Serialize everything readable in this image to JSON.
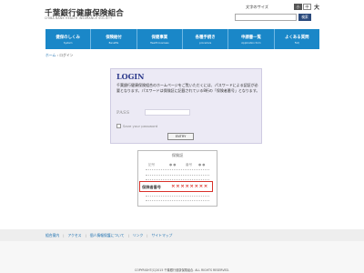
{
  "header": {
    "site_title": "千葉銀行健康保険組合",
    "site_subtitle": "CHIBA BANK HEALTH INSURANCE SOCIETY",
    "font_size_label": "文字のサイズ",
    "font_sizes": [
      "小",
      "中"
    ],
    "font_size_large": "大",
    "search_button": "検索"
  },
  "nav": [
    {
      "label": "健保のしくみ",
      "sub": "System"
    },
    {
      "label": "保険給付",
      "sub": "Benefits"
    },
    {
      "label": "保健事業",
      "sub": "Health business"
    },
    {
      "label": "各種手続き",
      "sub": "procedure"
    },
    {
      "label": "申請書一覧",
      "sub": "Application form"
    },
    {
      "label": "よくある質問",
      "sub": "FAQ"
    }
  ],
  "breadcrumb": {
    "home": "ホーム",
    "separator": "›",
    "current": "ログイン"
  },
  "login": {
    "title": "LOGIN",
    "description": "千葉銀行健康保険組合のホームページをご覧いただくには、パスワードによる認証が必要となります。パスワードは保険証に記載されている8桁の「保険者番号」となります。",
    "pass_label": "PASS",
    "save_label": "Save your password",
    "entry_button": "ENTRY"
  },
  "card": {
    "title": "保険証",
    "field1": "記号",
    "field1_value": "● ●",
    "field2": "番号",
    "field2_value": "● ●",
    "number_label": "保険者番号",
    "number_value": "××××××××"
  },
  "footer": {
    "links": [
      "組合案内",
      "アクセス",
      "個人情報保護について",
      "リンク",
      "サイトマップ"
    ],
    "copyright": "COPYRIGHT(C)2015 千葉銀行健康保険組合. ALL RIGHTS RESERVED."
  }
}
